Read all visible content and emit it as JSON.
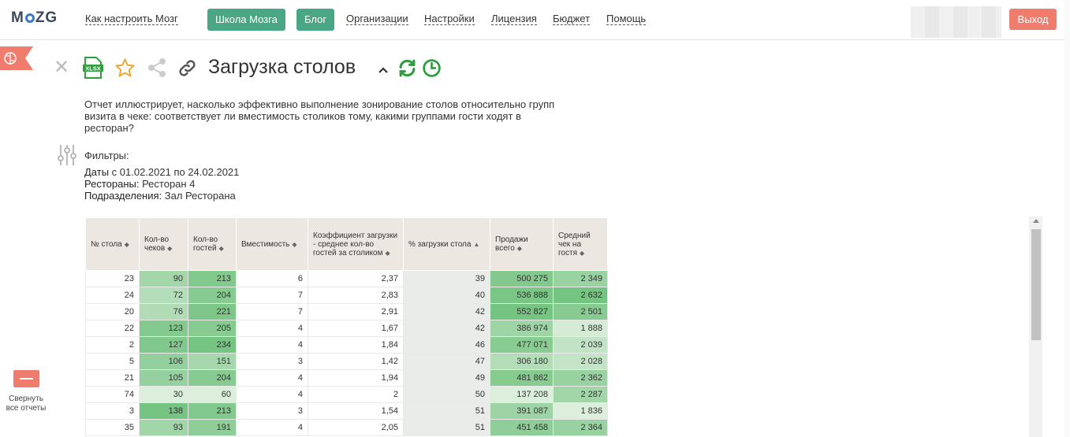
{
  "header": {
    "logo": "MOZG",
    "nav": {
      "how_to": "Как настроить Мозг",
      "school": "Школа Мозга",
      "blog": "Блог",
      "organizations": "Организации",
      "settings": "Настройки",
      "license": "Лицензия",
      "budget": "Бюджет",
      "help": "Помощь"
    },
    "exit_label": "Выход"
  },
  "sidebar": {
    "collapse_label": "Свернуть все отчеты"
  },
  "report": {
    "xlsx_label": "XLSX",
    "title": "Загрузка столов",
    "description": "Отчет иллюстрирует, насколько эффективно выполнение зонирование столов относительно групп визита в чеке: соответствует ли вместимость столиков тому, какими группами гости ходят в ресторан?",
    "filters": {
      "title": "Фильтры:",
      "dates_label": "Даты",
      "dates_value": " с 01.02.2021 по 24.02.2021",
      "restaurants_label": "Рестораны:",
      "restaurants_value": " Ресторан 4",
      "divisions_label": "Подразделения:",
      "divisions_value": " Зал Ресторана"
    }
  },
  "table": {
    "headers": [
      "№ стола",
      "Кол-во чеков",
      "Кол-во гостей",
      "Вместимость",
      "Коэффициент загрузки - среднее кол-во гостей за столиком",
      "% загрузки стола",
      "Продажи всего",
      "Средний чек на гостя"
    ],
    "rows": [
      [
        "23",
        "90",
        "213",
        "6",
        "2,37",
        "39",
        "500 275",
        "2 349"
      ],
      [
        "24",
        "72",
        "204",
        "7",
        "2,83",
        "40",
        "536 888",
        "2 632"
      ],
      [
        "20",
        "76",
        "221",
        "7",
        "2,91",
        "42",
        "552 827",
        "2 501"
      ],
      [
        "22",
        "123",
        "205",
        "4",
        "1,67",
        "42",
        "386 974",
        "1 888"
      ],
      [
        "2",
        "127",
        "234",
        "4",
        "1,84",
        "46",
        "477 071",
        "2 039"
      ],
      [
        "5",
        "106",
        "151",
        "3",
        "1,42",
        "47",
        "306 180",
        "2 028"
      ],
      [
        "21",
        "105",
        "204",
        "4",
        "1,94",
        "49",
        "481 862",
        "2 362"
      ],
      [
        "74",
        "30",
        "60",
        "4",
        "2",
        "50",
        "137 208",
        "2 287"
      ],
      [
        "3",
        "138",
        "213",
        "3",
        "1,54",
        "51",
        "391 087",
        "1 836"
      ],
      [
        "35",
        "93",
        "191",
        "4",
        "2,05",
        "51",
        "451 458",
        "2 364"
      ]
    ],
    "colors": {
      "header_bg": "#ece8e1",
      "pct_col_bg": "#e9ece9",
      "accent": "#4aa786"
    }
  }
}
